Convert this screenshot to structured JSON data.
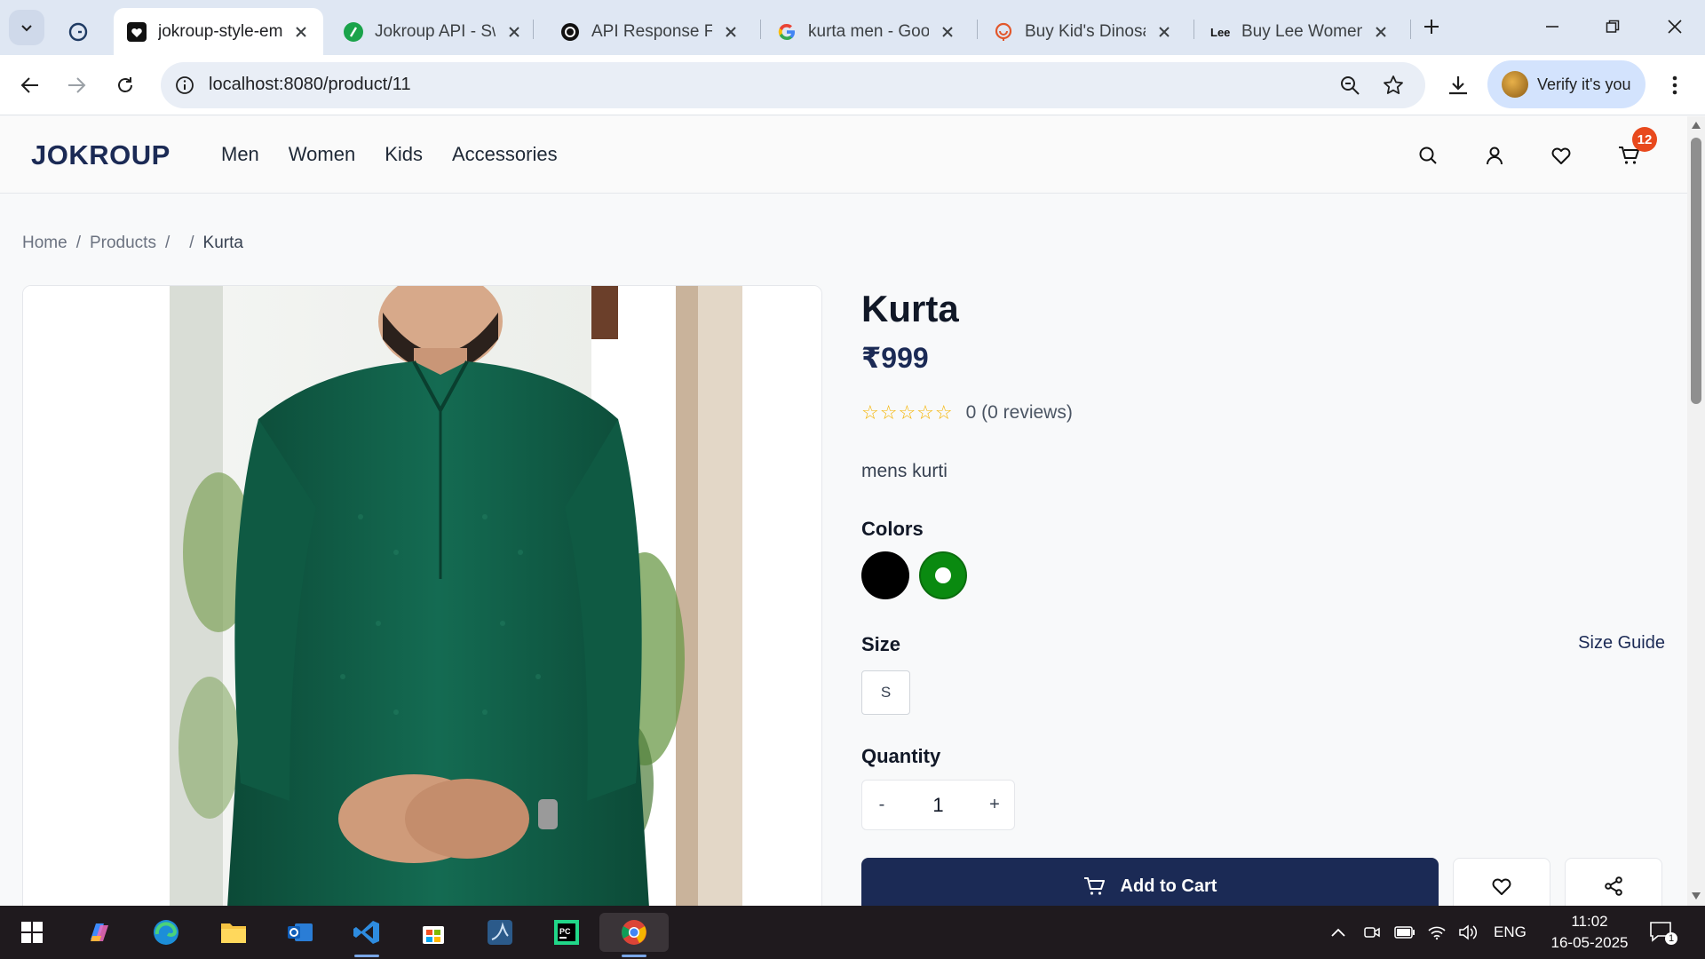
{
  "browser": {
    "tabs": [
      {
        "title": "",
        "favicon": "grammarly-icon"
      },
      {
        "title": "jokroup-style-em",
        "favicon": "heart-favicon",
        "active": true
      },
      {
        "title": "Jokroup API - Sw",
        "favicon": "swagger-icon"
      },
      {
        "title": "API Response For",
        "favicon": "openai-icon"
      },
      {
        "title": "kurta men - Goo",
        "favicon": "google-icon"
      },
      {
        "title": "Buy Kid's Dinosa",
        "favicon": "shop-icon"
      },
      {
        "title": "Buy Lee Women",
        "favicon": "lee-icon"
      }
    ],
    "url": "localhost:8080/product/11",
    "verify_label": "Verify it's you"
  },
  "site": {
    "logo": "JOKROUP",
    "nav": [
      "Men",
      "Women",
      "Kids",
      "Accessories"
    ],
    "cart_count": "12"
  },
  "breadcrumb": {
    "home": "Home",
    "sep1": "/",
    "products": "Products",
    "sep2": "/",
    "sep3": "/",
    "current": "Kurta"
  },
  "product": {
    "title": "Kurta",
    "price": "₹999",
    "stars_display": "☆☆☆☆☆",
    "rating": 0,
    "reviews_text": "0 (0 reviews)",
    "description": "mens kurti",
    "colors_label": "Colors",
    "colors": [
      {
        "name": "black",
        "hex": "#000000"
      },
      {
        "name": "green",
        "hex": "#0a8a10",
        "selected": true
      }
    ],
    "size_label": "Size",
    "size_guide": "Size Guide",
    "sizes": [
      "S"
    ],
    "quantity_label": "Quantity",
    "quantity": "1",
    "qty_minus": "-",
    "qty_plus": "+",
    "add_to_cart": "Add to Cart"
  },
  "taskbar": {
    "apps": [
      "start-icon",
      "copilot-icon",
      "edge-icon",
      "file-explorer-icon",
      "outlook-icon",
      "vscode-icon",
      "store-icon",
      "mysql-workbench-icon",
      "pycharm-icon",
      "chrome-icon"
    ],
    "language": "ENG",
    "time": "11:02",
    "date": "16-05-2025",
    "notification_count": "1"
  },
  "colors": {
    "brand_navy": "#1b2a55",
    "badge_orange": "#e8491d",
    "star_gold": "#f5b400",
    "kurta_green": "#0f5a43"
  }
}
